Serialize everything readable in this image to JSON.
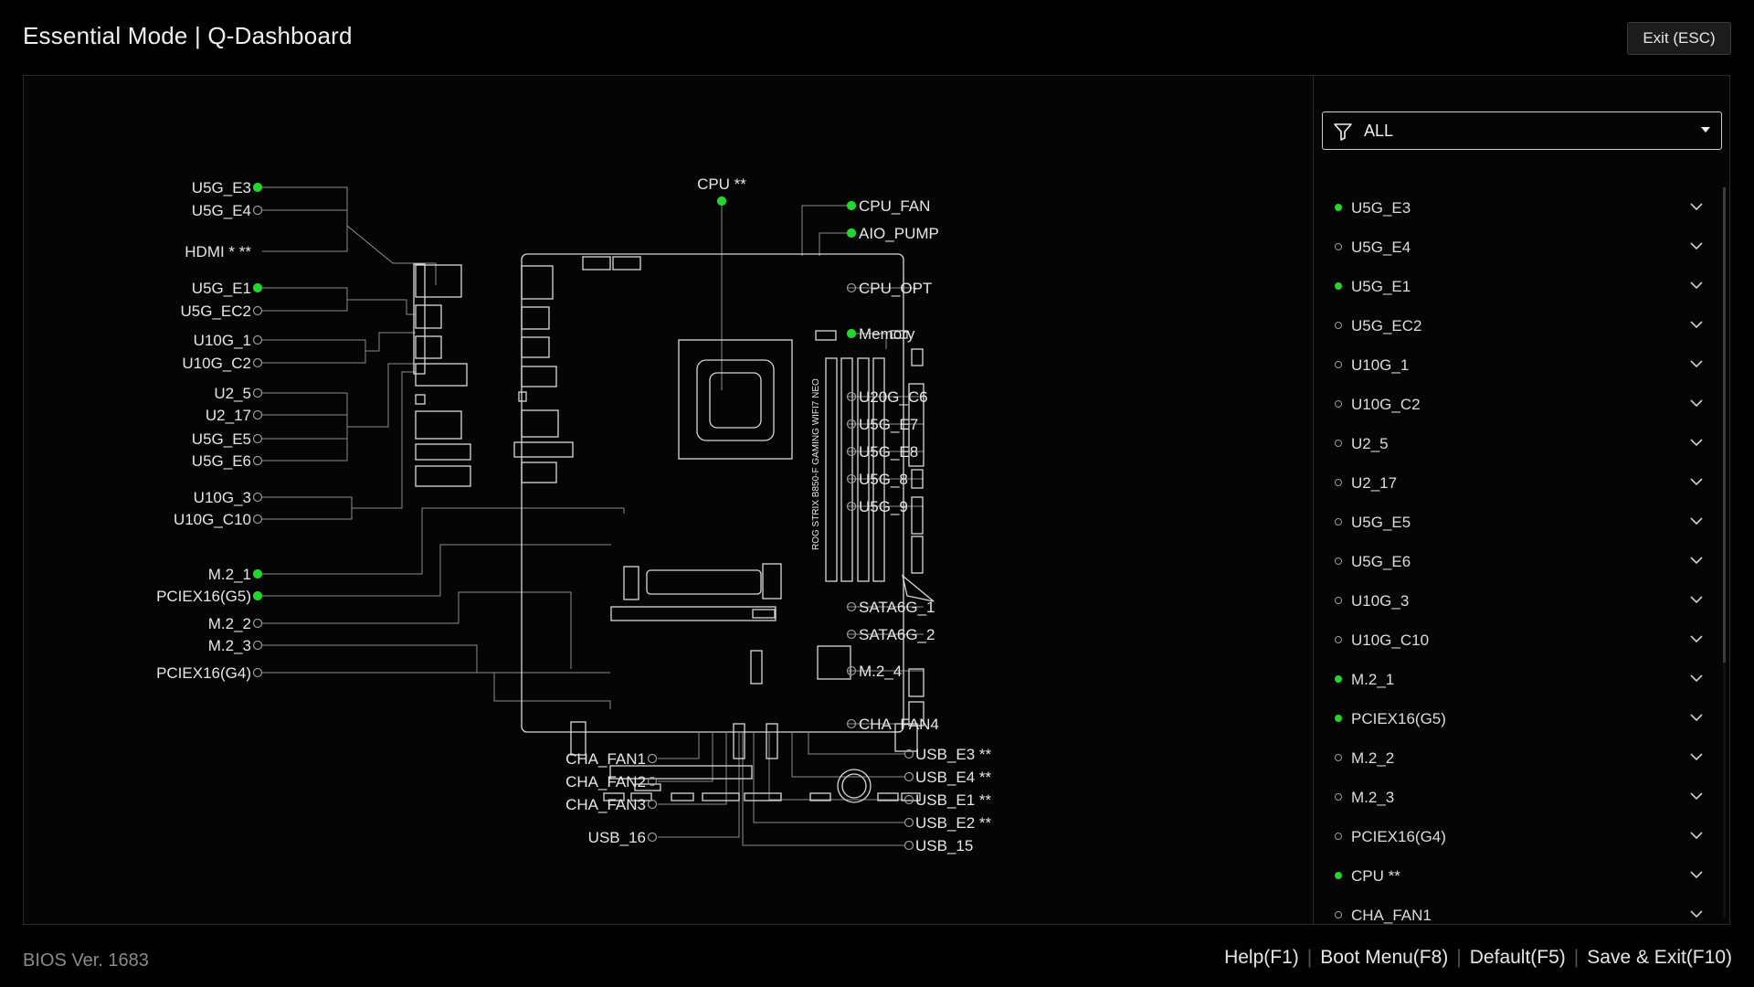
{
  "header": {
    "title": "Essential Mode | Q-Dashboard",
    "exit_label": "Exit (ESC)"
  },
  "colors": {
    "active": "#22d62b",
    "inactive": "#9a9a9a",
    "line": "#8c8c8c",
    "background": "#000000"
  },
  "board": {
    "model_text": "ROG STRIX B850-F GAMING WIFI7 NEO"
  },
  "labels_left": [
    {
      "id": "u5g-e3",
      "text": "U5G_E3",
      "active": true
    },
    {
      "id": "u5g-e4",
      "text": "U5G_E4",
      "active": false
    },
    {
      "id": "hdmi",
      "text": "HDMI * **",
      "active": false,
      "nodot": true
    },
    {
      "id": "u5g-e1",
      "text": "U5G_E1",
      "active": true
    },
    {
      "id": "u5g-ec2",
      "text": "U5G_EC2",
      "active": false
    },
    {
      "id": "u10g-1",
      "text": "U10G_1",
      "active": false
    },
    {
      "id": "u10g-c2",
      "text": "U10G_C2",
      "active": false
    },
    {
      "id": "u2-5",
      "text": "U2_5",
      "active": false
    },
    {
      "id": "u2-17",
      "text": "U2_17",
      "active": false
    },
    {
      "id": "u5g-e5",
      "text": "U5G_E5",
      "active": false
    },
    {
      "id": "u5g-e6",
      "text": "U5G_E6",
      "active": false
    },
    {
      "id": "u10g-3",
      "text": "U10G_3",
      "active": false
    },
    {
      "id": "u10g-c10",
      "text": "U10G_C10",
      "active": false
    },
    {
      "id": "m2-1",
      "text": "M.2_1",
      "active": true
    },
    {
      "id": "pciex16-g5",
      "text": "PCIEX16(G5)",
      "active": true
    },
    {
      "id": "m2-2",
      "text": "M.2_2",
      "active": false
    },
    {
      "id": "m2-3",
      "text": "M.2_3",
      "active": false
    },
    {
      "id": "pciex16-g4",
      "text": "PCIEX16(G4)",
      "active": false
    }
  ],
  "labels_right": [
    {
      "id": "cpu-fan",
      "text": "CPU_FAN",
      "active": true
    },
    {
      "id": "aio-pump",
      "text": "AIO_PUMP",
      "active": true
    },
    {
      "id": "cpu-opt",
      "text": "CPU_OPT",
      "active": false
    },
    {
      "id": "memory",
      "text": "Memory",
      "active": true
    },
    {
      "id": "u20g-c6",
      "text": "U20G_C6",
      "active": false
    },
    {
      "id": "u5g-e7",
      "text": "U5G_E7",
      "active": false
    },
    {
      "id": "u5g-e8",
      "text": "U5G_E8",
      "active": false
    },
    {
      "id": "u5g-8",
      "text": "U5G_8",
      "active": false
    },
    {
      "id": "u5g-9",
      "text": "U5G_9",
      "active": false
    },
    {
      "id": "sata6g-1",
      "text": "SATA6G_1",
      "active": false
    },
    {
      "id": "sata6g-2",
      "text": "SATA6G_2",
      "active": false
    },
    {
      "id": "m2-4",
      "text": "M.2_4",
      "active": false
    },
    {
      "id": "cha-fan4",
      "text": "CHA_FAN4",
      "active": false
    }
  ],
  "labels_top": [
    {
      "id": "cpu",
      "text": "CPU **",
      "active": true
    }
  ],
  "labels_bottom_left": [
    {
      "id": "cha-fan1",
      "text": "CHA_FAN1",
      "active": false
    },
    {
      "id": "cha-fan2",
      "text": "CHA_FAN2",
      "active": false
    },
    {
      "id": "cha-fan3",
      "text": "CHA_FAN3",
      "active": false
    },
    {
      "id": "usb-16",
      "text": "USB_16",
      "active": false
    }
  ],
  "labels_bottom_right": [
    {
      "id": "usb-e3",
      "text": "USB_E3 **",
      "active": false
    },
    {
      "id": "usb-e4",
      "text": "USB_E4 **",
      "active": false
    },
    {
      "id": "usb-e1",
      "text": "USB_E1 **",
      "active": false
    },
    {
      "id": "usb-e2",
      "text": "USB_E2 **",
      "active": false
    },
    {
      "id": "usb-15",
      "text": "USB_15",
      "active": false
    }
  ],
  "sidebar": {
    "filter_value": "ALL",
    "items": [
      {
        "label": "U5G_E3",
        "active": true
      },
      {
        "label": "U5G_E4",
        "active": false
      },
      {
        "label": "U5G_E1",
        "active": true
      },
      {
        "label": "U5G_EC2",
        "active": false
      },
      {
        "label": "U10G_1",
        "active": false
      },
      {
        "label": "U10G_C2",
        "active": false
      },
      {
        "label": "U2_5",
        "active": false
      },
      {
        "label": "U2_17",
        "active": false
      },
      {
        "label": "U5G_E5",
        "active": false
      },
      {
        "label": "U5G_E6",
        "active": false
      },
      {
        "label": "U10G_3",
        "active": false
      },
      {
        "label": "U10G_C10",
        "active": false
      },
      {
        "label": "M.2_1",
        "active": true
      },
      {
        "label": "PCIEX16(G5)",
        "active": true
      },
      {
        "label": "M.2_2",
        "active": false
      },
      {
        "label": "M.2_3",
        "active": false
      },
      {
        "label": "PCIEX16(G4)",
        "active": false
      },
      {
        "label": "CPU **",
        "active": true
      },
      {
        "label": "CHA_FAN1",
        "active": false
      }
    ]
  },
  "footer": {
    "bios_version": "BIOS Ver. 1683",
    "help": "Help(F1)",
    "boot_menu": "Boot Menu(F8)",
    "default": "Default(F5)",
    "save_exit": "Save & Exit(F10)"
  }
}
